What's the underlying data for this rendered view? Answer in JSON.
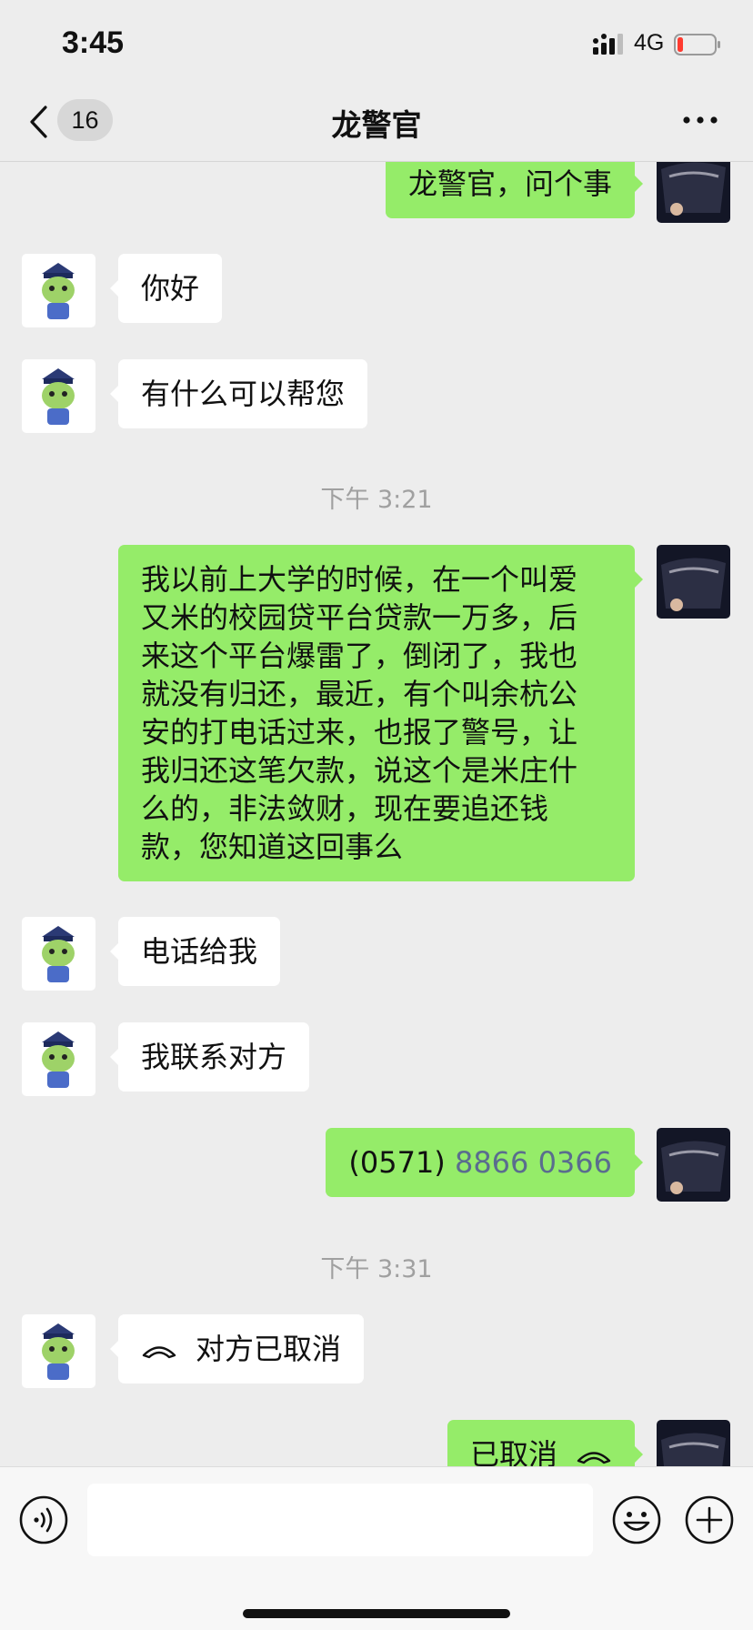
{
  "status_bar": {
    "time": "3:45",
    "network": "4G"
  },
  "nav": {
    "unread_count": "16",
    "title": "龙警官"
  },
  "messages": [
    {
      "side": "out",
      "text": "龙警官，问个事"
    },
    {
      "side": "in",
      "text": "你好"
    },
    {
      "side": "in",
      "text": "有什么可以帮您"
    },
    {
      "type": "time",
      "text": "下午 3:21"
    },
    {
      "side": "out",
      "lines": [
        "我以前上大学的时候，在一个叫爱",
        "又米的校园贷平台贷款一万多，后",
        "来这个平台爆雷了，倒闭了，我也",
        "就没有归还，最近，有个叫余杭公",
        "安的打电话过来，也报了警号，让",
        "我归还这笔欠款，说这个是米庄什",
        "么的，非法敛财，现在要追还钱",
        "款，您知道这回事么"
      ]
    },
    {
      "side": "in",
      "text": "电话给我"
    },
    {
      "side": "in",
      "text": "我联系对方"
    },
    {
      "side": "out",
      "area_code": "(0571)",
      "phone_number": "8866 0366"
    },
    {
      "type": "time",
      "text": "下午 3:31"
    },
    {
      "side": "in",
      "call_status": "对方已取消",
      "icon": "phone-hangup-icon"
    },
    {
      "side": "out",
      "call_status": "已取消",
      "icon": "phone-hangup-icon"
    }
  ],
  "colors": {
    "background": "#ededed",
    "bubble_out": "#95ec69",
    "bubble_in": "#ffffff",
    "link": "#5a6d8e"
  },
  "input": {
    "value": "",
    "placeholder": ""
  }
}
